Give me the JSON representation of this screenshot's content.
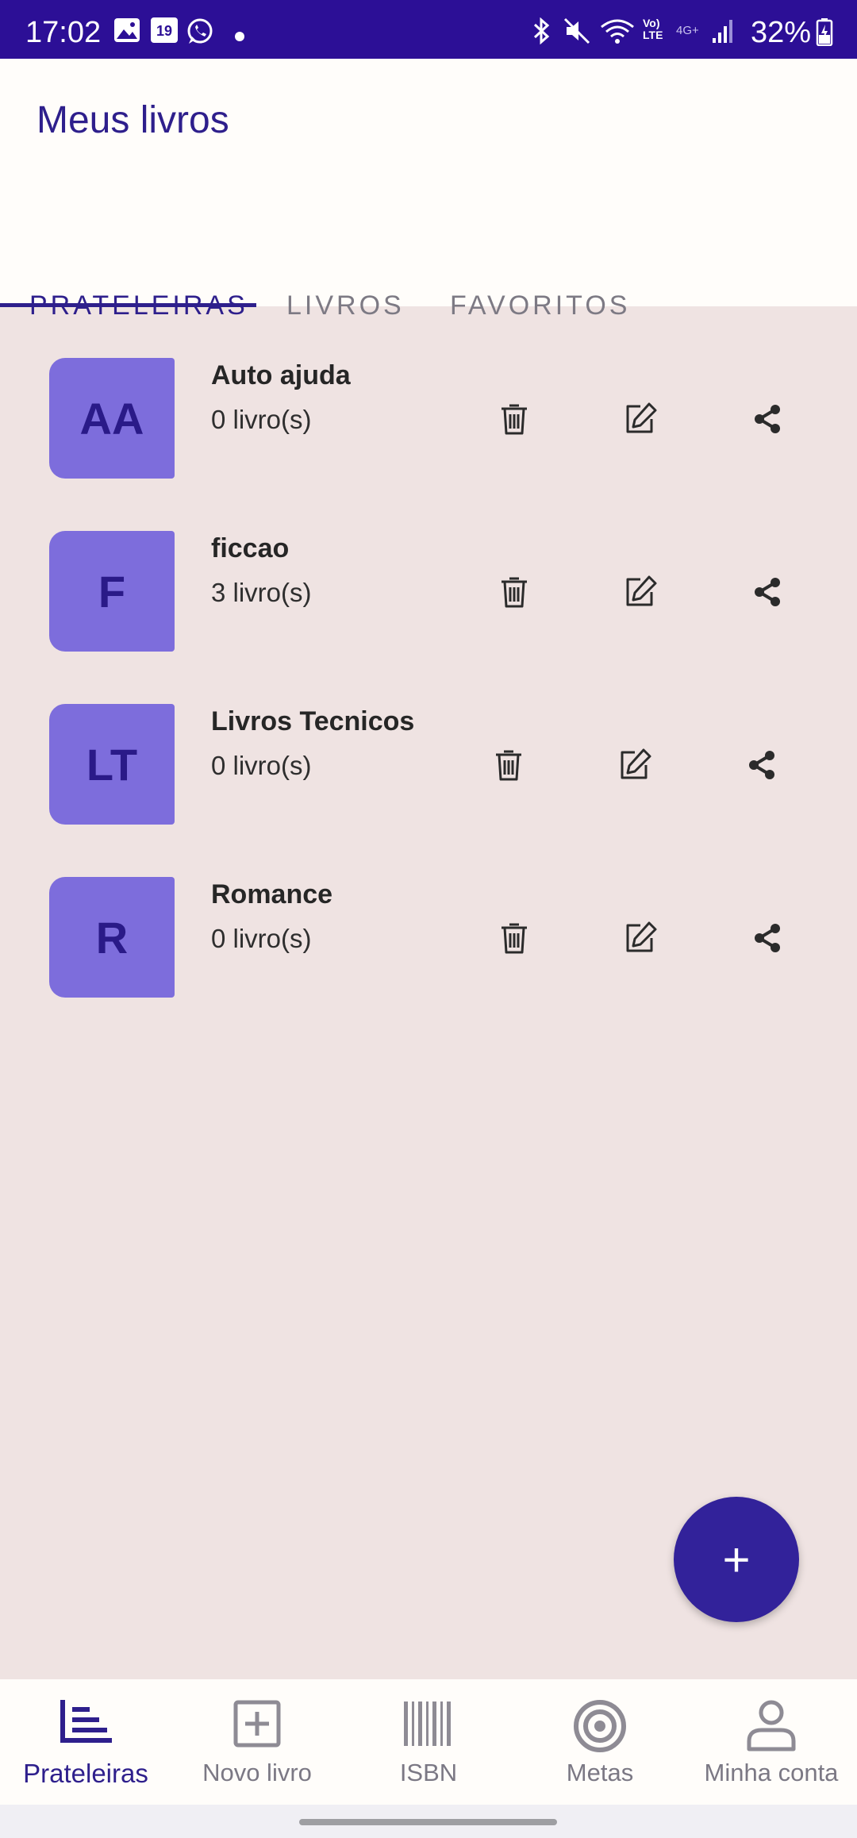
{
  "status_bar": {
    "time": "17:02",
    "battery": "32%",
    "calendar_day": "19",
    "network_label": "Vo) LTE",
    "network_gen": "4G+"
  },
  "app_bar": {
    "title": "Meus livros"
  },
  "tabs": [
    {
      "label": "PRATELEIRAS",
      "active": true
    },
    {
      "label": "LIVROS",
      "active": false
    },
    {
      "label": "FAVORITOS",
      "active": false
    }
  ],
  "shelves": [
    {
      "initials": "AA",
      "name": "Auto ajuda",
      "count": "0 livro(s)"
    },
    {
      "initials": "F",
      "name": "ficcao",
      "count": "3 livro(s)"
    },
    {
      "initials": "LT",
      "name": "Livros Tecnicos",
      "count": "0 livro(s)"
    },
    {
      "initials": "R",
      "name": "Romance",
      "count": "0 livro(s)"
    }
  ],
  "fab": {
    "label": "+"
  },
  "bottom_nav": [
    {
      "label": "Prateleiras",
      "icon": "shelves-icon",
      "active": true
    },
    {
      "label": "Novo livro",
      "icon": "add-box-icon",
      "active": false
    },
    {
      "label": "ISBN",
      "icon": "barcode-icon",
      "active": false
    },
    {
      "label": "Metas",
      "icon": "target-icon",
      "active": false
    },
    {
      "label": "Minha conta",
      "icon": "person-icon",
      "active": false
    }
  ],
  "colors": {
    "primary": "#2e1f8c",
    "status_bar": "#2c0f96",
    "avatar_bg": "#7d6ddc",
    "list_bg": "#efe3e2",
    "fab": "#32229a"
  }
}
